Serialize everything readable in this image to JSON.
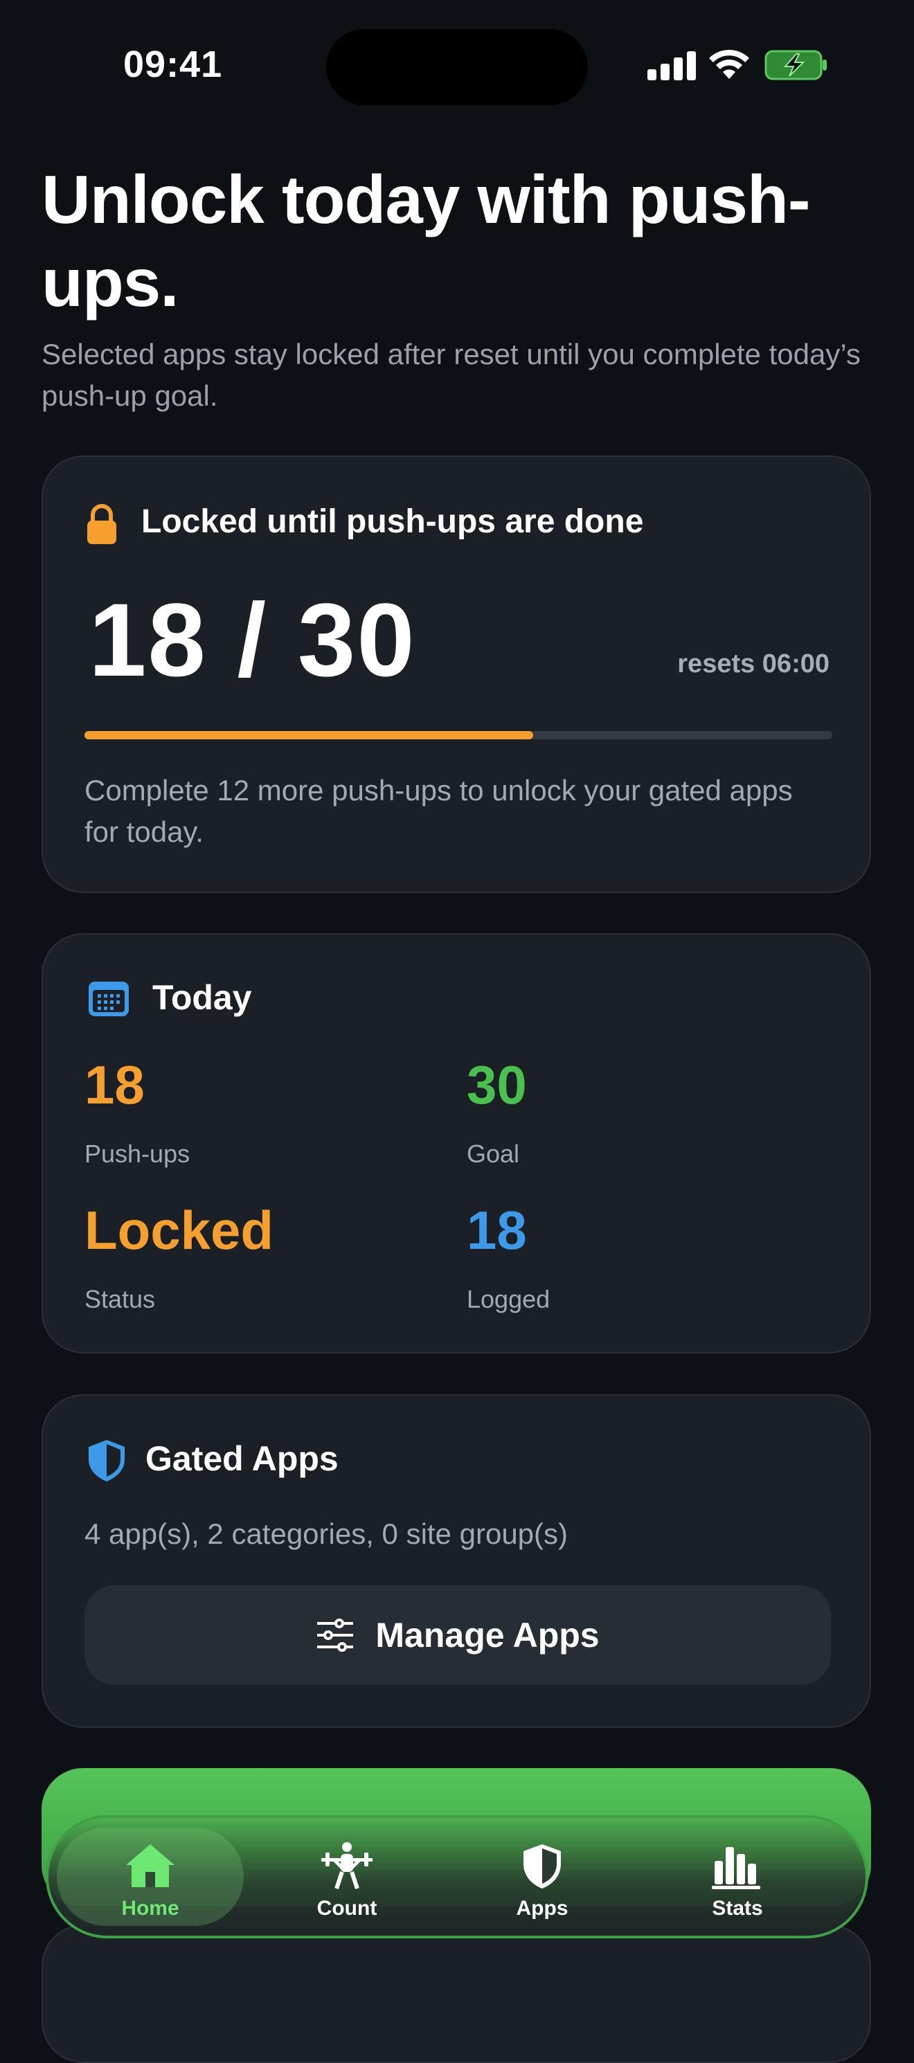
{
  "status_bar": {
    "time": "09:41"
  },
  "hero": {
    "title": "Unlock today with push-ups.",
    "subtitle": "Selected apps stay locked after reset until you complete today’s push-up goal."
  },
  "lock_card": {
    "title": "Locked until push-ups are done",
    "progress": "18 / 30",
    "progress_fraction": 0.6,
    "resets": "resets 06:00",
    "hint": "Complete 12 more push-ups to unlock your gated apps for today.",
    "accent_color": "#f59f2e"
  },
  "today_card": {
    "title": "Today",
    "stats": [
      {
        "value": "18",
        "label": "Push-ups",
        "color": "#f59f2e"
      },
      {
        "value": "30",
        "label": "Goal",
        "color": "#4cc04f"
      },
      {
        "value": "Locked",
        "label": "Status",
        "color": "#f59f2e"
      },
      {
        "value": "18",
        "label": "Logged",
        "color": "#3d9ae8"
      }
    ]
  },
  "gated_card": {
    "title": "Gated Apps",
    "summary": "4 app(s), 2 categories, 0 site group(s)",
    "manage_label": "Manage Apps"
  },
  "tab_bar": {
    "tabs": [
      {
        "label": "Home",
        "icon": "house-icon",
        "active": true
      },
      {
        "label": "Count",
        "icon": "weightlifter-icon",
        "active": false
      },
      {
        "label": "Apps",
        "icon": "shield-icon",
        "active": false
      },
      {
        "label": "Stats",
        "icon": "bar-chart-icon",
        "active": false
      }
    ]
  },
  "colors": {
    "background": "#0d1116",
    "card": "#1b2026",
    "cta_green": "#4cb751",
    "active_tab": "#6ee872"
  }
}
